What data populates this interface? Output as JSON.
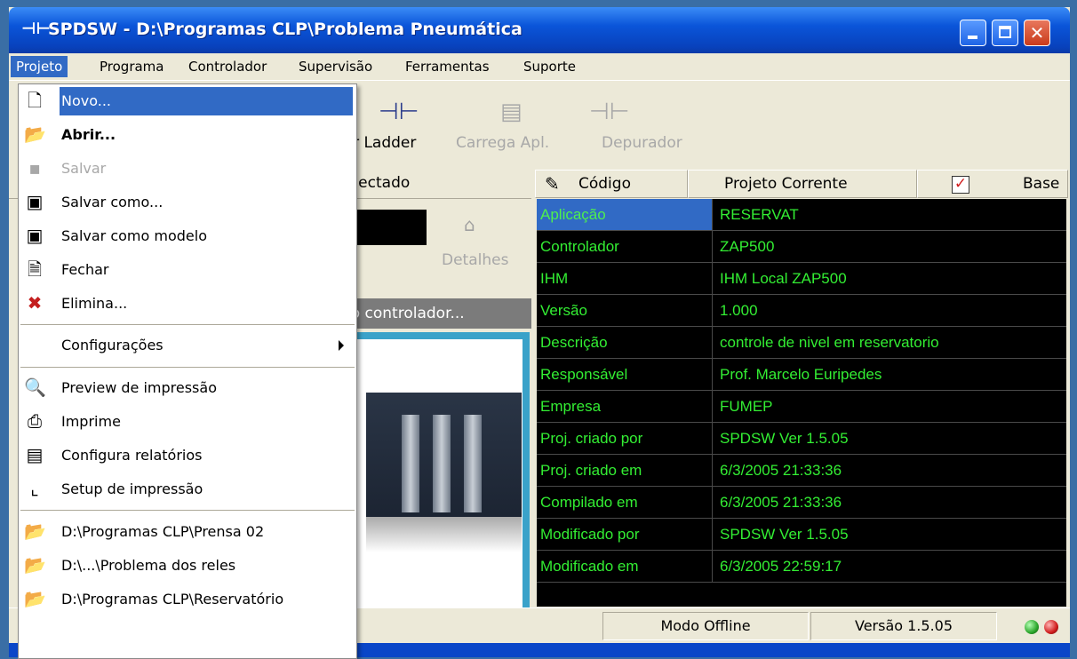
{
  "window": {
    "app_icon": "ladder-app-icon",
    "title": "SPDSW - D:\\Programas CLP\\Problema Pneumática"
  },
  "menubar": [
    "Projeto",
    "Programa",
    "Controlador",
    "Supervisão",
    "Ferramentas",
    "Suporte"
  ],
  "toolbar": {
    "editor": "tor Ladder",
    "carrega": "Carrega Apl.",
    "depurador": "Depurador"
  },
  "left": {
    "connection": "onectado",
    "details": "Detalhes",
    "controller_bar": "io controlador..."
  },
  "grid": {
    "tab_codigo": "Código",
    "tab_projeto": "Projeto Corrente",
    "tab_base": "Base",
    "rows": [
      {
        "label": "Aplicação",
        "value": "RESERVAT"
      },
      {
        "label": "Controlador",
        "value": "ZAP500"
      },
      {
        "label": "IHM",
        "value": "IHM Local ZAP500"
      },
      {
        "label": "Versão",
        "value": "1.000"
      },
      {
        "label": "Descrição",
        "value": "controle de nivel em reservatorio"
      },
      {
        "label": "Responsável",
        "value": "Prof. Marcelo Euripedes"
      },
      {
        "label": "Empresa",
        "value": "FUMEP"
      },
      {
        "label": "Proj. criado por",
        "value": "SPDSW Ver 1.5.05"
      },
      {
        "label": "Proj. criado em",
        "value": "6/3/2005 21:33:36"
      },
      {
        "label": "Compilado em",
        "value": "6/3/2005 21:33:36"
      },
      {
        "label": "Modificado por",
        "value": "SPDSW Ver 1.5.05"
      },
      {
        "label": "Modificado em",
        "value": "6/3/2005 22:59:17"
      }
    ]
  },
  "statusbar": {
    "mode": "Modo Offline",
    "version": "Versão 1.5.05"
  },
  "menu_projeto": {
    "novo": "Novo...",
    "abrir": "Abrir...",
    "salvar": "Salvar",
    "salvar_como": "Salvar como...",
    "salvar_modelo": "Salvar como modelo",
    "fechar": "Fechar",
    "elimina": "Elimina...",
    "configuracoes": "Configurações",
    "preview": "Preview de impressão",
    "imprime": "Imprime",
    "configura_rel": "Configura relatórios",
    "setup": "Setup de impressão",
    "recent1": "D:\\Programas CLP\\Prensa 02",
    "recent2": "D:\\...\\Problema dos reles",
    "recent3": "D:\\Programas CLP\\Reservatório"
  }
}
